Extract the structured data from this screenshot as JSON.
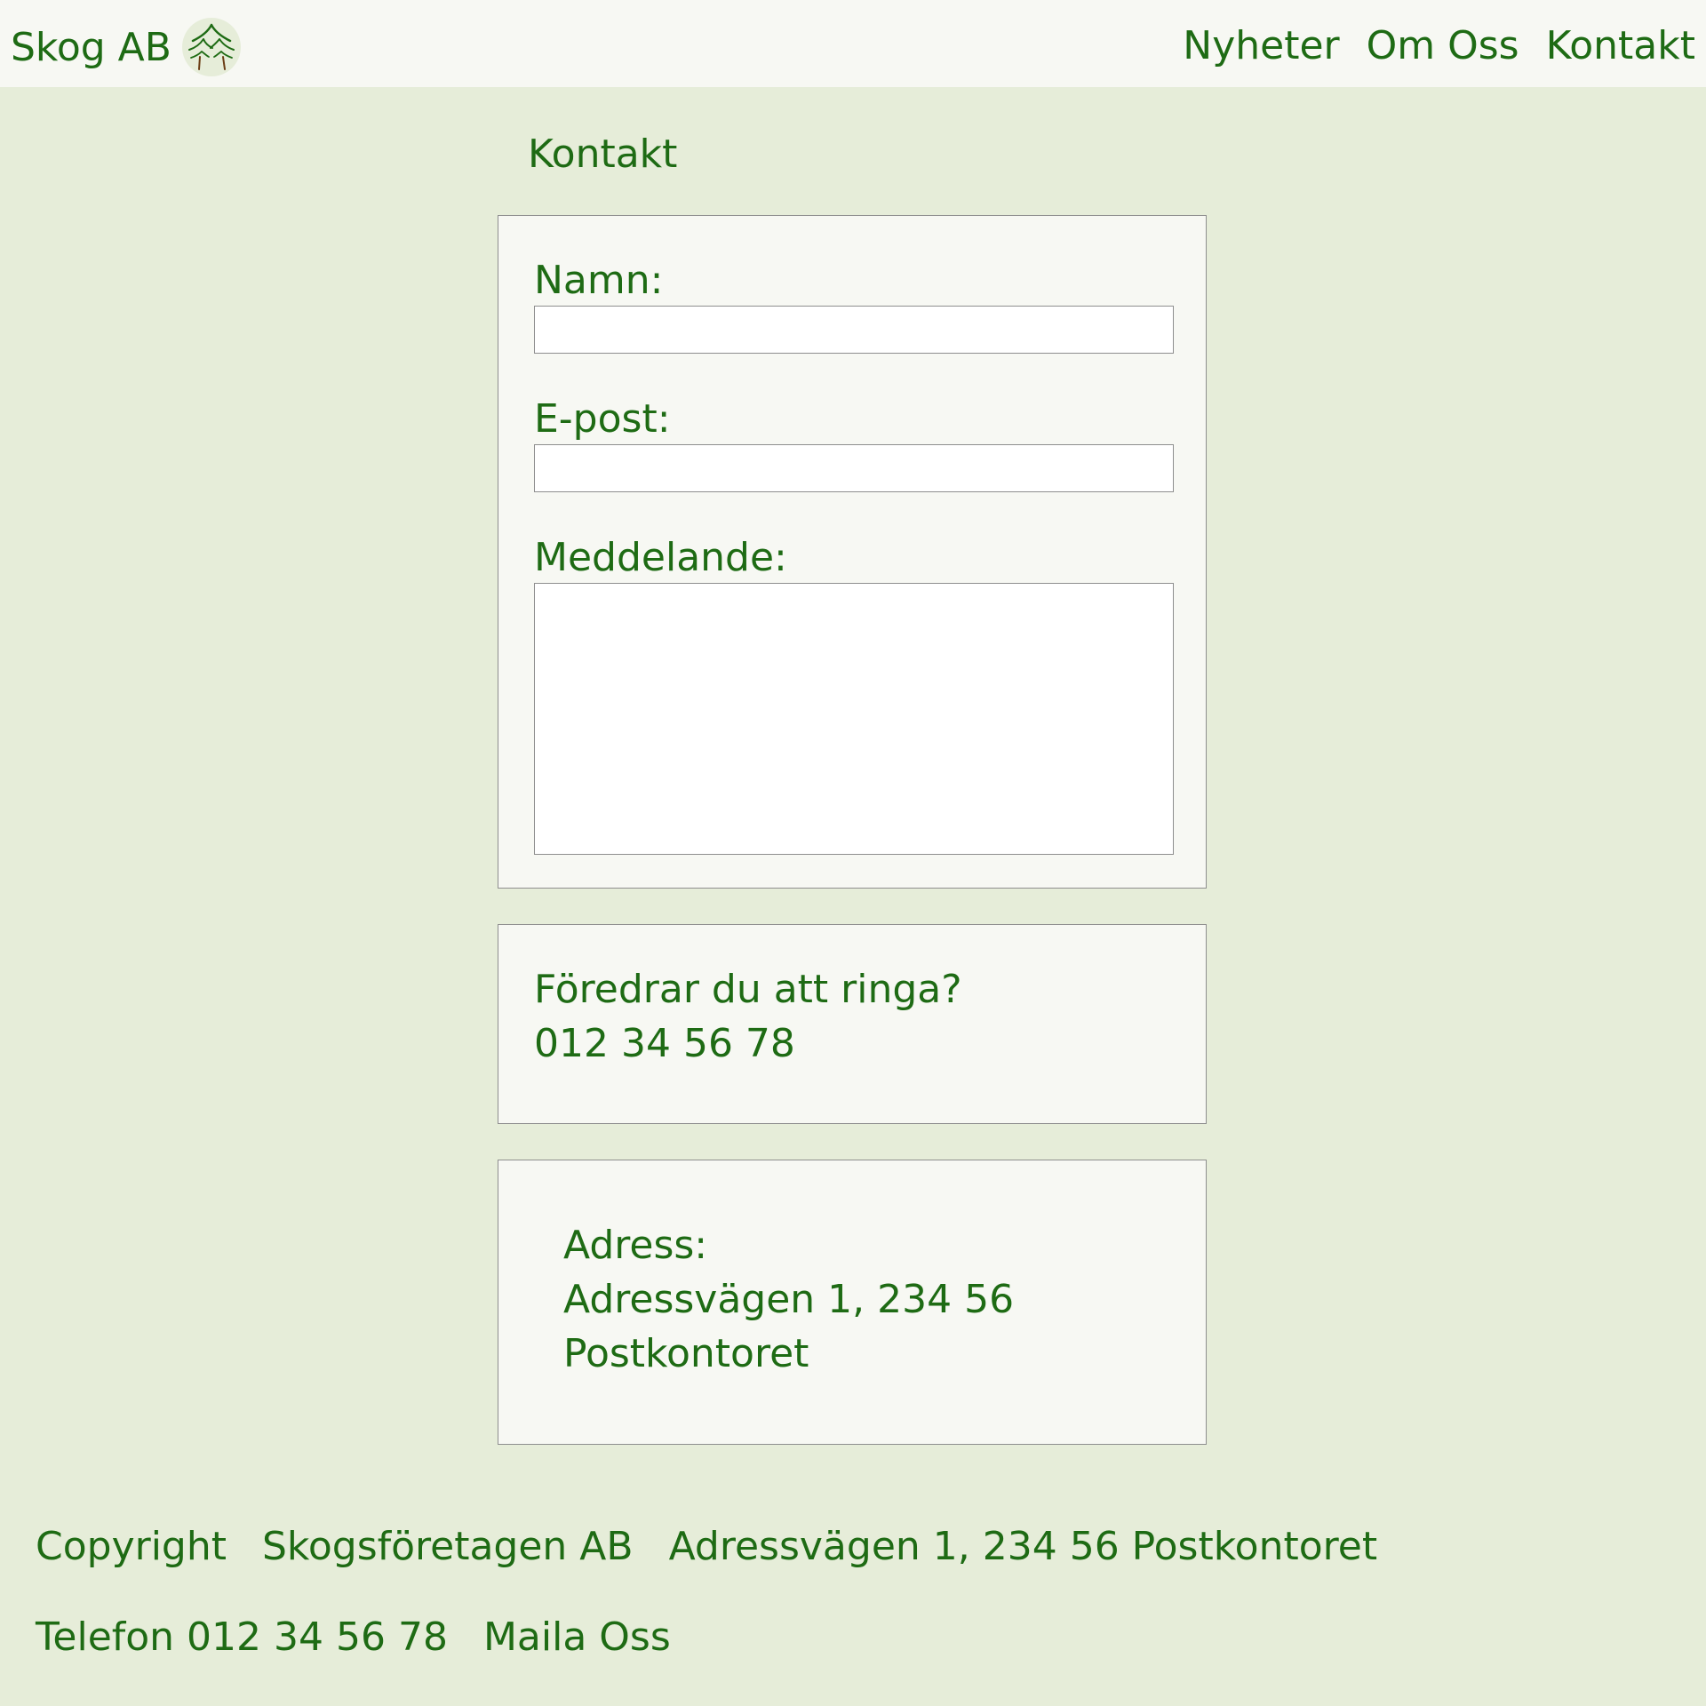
{
  "header": {
    "brand_name": "Skog AB",
    "logo_icon": "tree-icon",
    "nav": [
      {
        "label": "Nyheter"
      },
      {
        "label": "Om Oss"
      },
      {
        "label": "Kontakt"
      }
    ]
  },
  "page": {
    "title": "Kontakt"
  },
  "form": {
    "name_label": "Namn:",
    "name_value": "",
    "email_label": "E-post:",
    "email_value": "",
    "message_label": "Meddelande:",
    "message_value": ""
  },
  "phone_box": {
    "prompt": "Föredrar du att ringa?",
    "number": "012 34 56 78"
  },
  "address_box": {
    "label": "Adress:",
    "street": "Adressvägen 1, 234 56",
    "city": "Postkontoret"
  },
  "footer": {
    "copyright": "Copyright",
    "company": "Skogsföretagen AB",
    "address": "Adressvägen 1, 234 56 Postkontoret",
    "phone": "Telefon 012 34 56 78",
    "mail_link": "Maila Oss"
  },
  "colors": {
    "background": "#e6edd9",
    "panel": "#f7f8f3",
    "text": "#1e6b14",
    "border": "#8e8e8e"
  }
}
